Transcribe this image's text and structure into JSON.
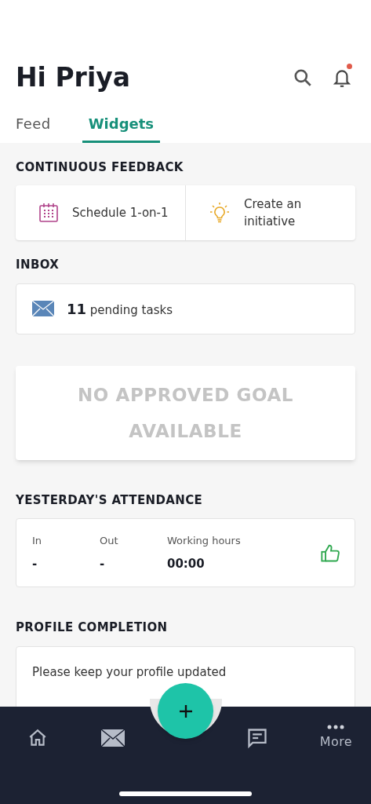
{
  "header": {
    "greeting": "Hi Priya",
    "notification_dot": true
  },
  "tabs": [
    {
      "label": "Feed",
      "selected": false
    },
    {
      "label": "Widgets",
      "selected": true
    }
  ],
  "continuous_feedback": {
    "title": "CONTINUOUS FEEDBACK",
    "actions": [
      {
        "kind": "calendar",
        "label": "Schedule 1-on-1"
      },
      {
        "kind": "bulb",
        "label": "Create an initiative"
      }
    ]
  },
  "inbox": {
    "title": "INBOX",
    "count": "11",
    "label": "pending tasks"
  },
  "goal": {
    "message": "NO APPROVED GOAL AVAILABLE"
  },
  "attendance": {
    "title": "YESTERDAY'S ATTENDANCE",
    "columns": [
      {
        "label": "In",
        "value": "-"
      },
      {
        "label": "Out",
        "value": "-"
      },
      {
        "label": "Working hours",
        "value": "00:00"
      }
    ]
  },
  "profile": {
    "title": "PROFILE COMPLETION",
    "message": "Please keep your profile updated"
  },
  "bottom_nav": [
    {
      "kind": "home"
    },
    {
      "kind": "mail"
    },
    {
      "kind": "chat"
    },
    {
      "kind": "more",
      "label": "More"
    }
  ]
}
